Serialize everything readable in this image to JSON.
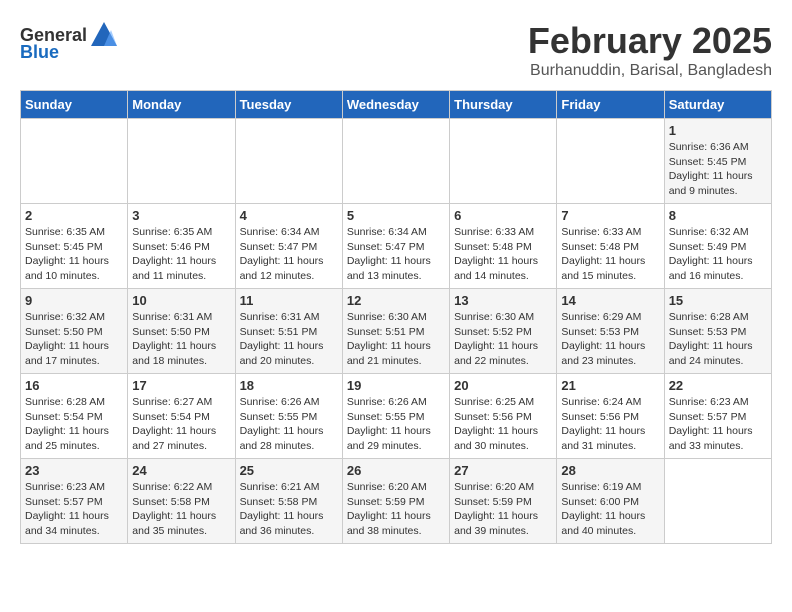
{
  "header": {
    "logo_general": "General",
    "logo_blue": "Blue",
    "month": "February 2025",
    "location": "Burhanuddin, Barisal, Bangladesh"
  },
  "days_of_week": [
    "Sunday",
    "Monday",
    "Tuesday",
    "Wednesday",
    "Thursday",
    "Friday",
    "Saturday"
  ],
  "weeks": [
    [
      {
        "day": "",
        "info": ""
      },
      {
        "day": "",
        "info": ""
      },
      {
        "day": "",
        "info": ""
      },
      {
        "day": "",
        "info": ""
      },
      {
        "day": "",
        "info": ""
      },
      {
        "day": "",
        "info": ""
      },
      {
        "day": "1",
        "info": "Sunrise: 6:36 AM\nSunset: 5:45 PM\nDaylight: 11 hours\nand 9 minutes."
      }
    ],
    [
      {
        "day": "2",
        "info": "Sunrise: 6:35 AM\nSunset: 5:45 PM\nDaylight: 11 hours\nand 10 minutes."
      },
      {
        "day": "3",
        "info": "Sunrise: 6:35 AM\nSunset: 5:46 PM\nDaylight: 11 hours\nand 11 minutes."
      },
      {
        "day": "4",
        "info": "Sunrise: 6:34 AM\nSunset: 5:47 PM\nDaylight: 11 hours\nand 12 minutes."
      },
      {
        "day": "5",
        "info": "Sunrise: 6:34 AM\nSunset: 5:47 PM\nDaylight: 11 hours\nand 13 minutes."
      },
      {
        "day": "6",
        "info": "Sunrise: 6:33 AM\nSunset: 5:48 PM\nDaylight: 11 hours\nand 14 minutes."
      },
      {
        "day": "7",
        "info": "Sunrise: 6:33 AM\nSunset: 5:48 PM\nDaylight: 11 hours\nand 15 minutes."
      },
      {
        "day": "8",
        "info": "Sunrise: 6:32 AM\nSunset: 5:49 PM\nDaylight: 11 hours\nand 16 minutes."
      }
    ],
    [
      {
        "day": "9",
        "info": "Sunrise: 6:32 AM\nSunset: 5:50 PM\nDaylight: 11 hours\nand 17 minutes."
      },
      {
        "day": "10",
        "info": "Sunrise: 6:31 AM\nSunset: 5:50 PM\nDaylight: 11 hours\nand 18 minutes."
      },
      {
        "day": "11",
        "info": "Sunrise: 6:31 AM\nSunset: 5:51 PM\nDaylight: 11 hours\nand 20 minutes."
      },
      {
        "day": "12",
        "info": "Sunrise: 6:30 AM\nSunset: 5:51 PM\nDaylight: 11 hours\nand 21 minutes."
      },
      {
        "day": "13",
        "info": "Sunrise: 6:30 AM\nSunset: 5:52 PM\nDaylight: 11 hours\nand 22 minutes."
      },
      {
        "day": "14",
        "info": "Sunrise: 6:29 AM\nSunset: 5:53 PM\nDaylight: 11 hours\nand 23 minutes."
      },
      {
        "day": "15",
        "info": "Sunrise: 6:28 AM\nSunset: 5:53 PM\nDaylight: 11 hours\nand 24 minutes."
      }
    ],
    [
      {
        "day": "16",
        "info": "Sunrise: 6:28 AM\nSunset: 5:54 PM\nDaylight: 11 hours\nand 25 minutes."
      },
      {
        "day": "17",
        "info": "Sunrise: 6:27 AM\nSunset: 5:54 PM\nDaylight: 11 hours\nand 27 minutes."
      },
      {
        "day": "18",
        "info": "Sunrise: 6:26 AM\nSunset: 5:55 PM\nDaylight: 11 hours\nand 28 minutes."
      },
      {
        "day": "19",
        "info": "Sunrise: 6:26 AM\nSunset: 5:55 PM\nDaylight: 11 hours\nand 29 minutes."
      },
      {
        "day": "20",
        "info": "Sunrise: 6:25 AM\nSunset: 5:56 PM\nDaylight: 11 hours\nand 30 minutes."
      },
      {
        "day": "21",
        "info": "Sunrise: 6:24 AM\nSunset: 5:56 PM\nDaylight: 11 hours\nand 31 minutes."
      },
      {
        "day": "22",
        "info": "Sunrise: 6:23 AM\nSunset: 5:57 PM\nDaylight: 11 hours\nand 33 minutes."
      }
    ],
    [
      {
        "day": "23",
        "info": "Sunrise: 6:23 AM\nSunset: 5:57 PM\nDaylight: 11 hours\nand 34 minutes."
      },
      {
        "day": "24",
        "info": "Sunrise: 6:22 AM\nSunset: 5:58 PM\nDaylight: 11 hours\nand 35 minutes."
      },
      {
        "day": "25",
        "info": "Sunrise: 6:21 AM\nSunset: 5:58 PM\nDaylight: 11 hours\nand 36 minutes."
      },
      {
        "day": "26",
        "info": "Sunrise: 6:20 AM\nSunset: 5:59 PM\nDaylight: 11 hours\nand 38 minutes."
      },
      {
        "day": "27",
        "info": "Sunrise: 6:20 AM\nSunset: 5:59 PM\nDaylight: 11 hours\nand 39 minutes."
      },
      {
        "day": "28",
        "info": "Sunrise: 6:19 AM\nSunset: 6:00 PM\nDaylight: 11 hours\nand 40 minutes."
      },
      {
        "day": "",
        "info": ""
      }
    ]
  ]
}
